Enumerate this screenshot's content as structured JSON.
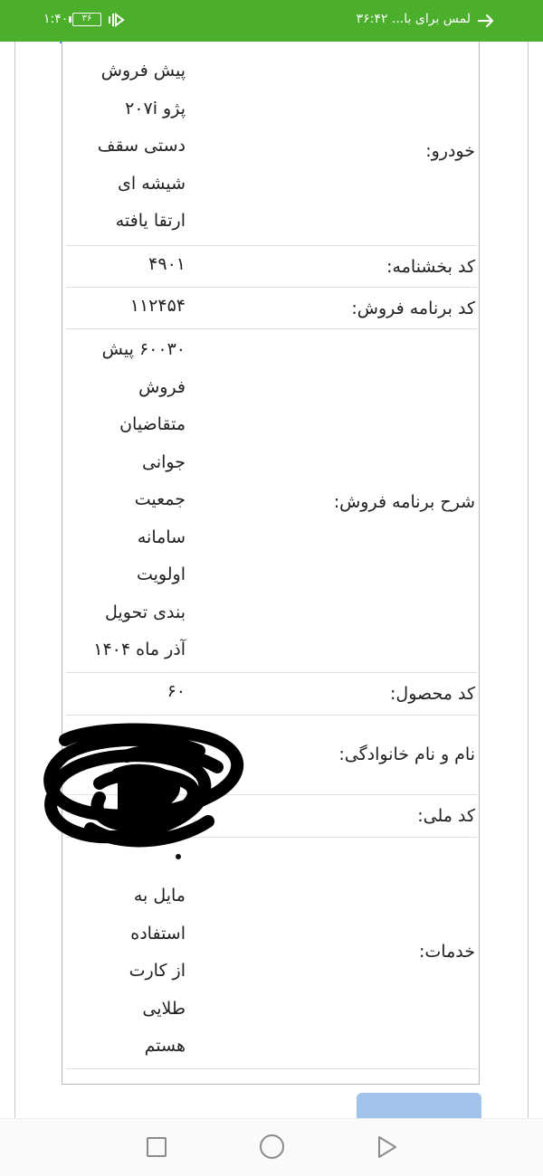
{
  "status_bar": {
    "time": "۱:۴۰",
    "battery": "۳۶",
    "timer": "۳۶:۴۲",
    "label": "لمس برای با..."
  },
  "rows": [
    {
      "label": "خودرو:",
      "value": [
        "پیش فروش",
        "پژو ۲۰۷i",
        "دستی سقف",
        "شیشه ای",
        "ارتقا یافته"
      ]
    },
    {
      "label": "کد بخشنامه:",
      "value": [
        "۴۹۰۱"
      ]
    },
    {
      "label": "کد برنامه فروش:",
      "value": [
        "۱۱۲۴۵۴"
      ]
    },
    {
      "label": "شرح برنامه فروش:",
      "value": [
        "۶۰۰۳۰ پیش",
        "فروش",
        "متقاضیان",
        "جوانی",
        "جمعیت",
        "سامانه",
        "اولویت",
        "بندی تحویل",
        "آذر ماه ۱۴۰۴"
      ]
    },
    {
      "label": "کد محصول:",
      "value": [
        "۶۰"
      ]
    },
    {
      "label": "نام و نام خانوادگی:",
      "value": [
        "فا..."
      ]
    },
    {
      "label": "کد ملی:",
      "value": [
        "۰"
      ]
    },
    {
      "label": "خدمات:",
      "value": [
        "مایل به",
        "استفاده",
        "از کارت",
        "طلایی",
        "هستم"
      ]
    }
  ],
  "colors": {
    "status_bar": "#4caf2b",
    "accent_line": "#4a90e2",
    "button": "#a3c4ea"
  }
}
